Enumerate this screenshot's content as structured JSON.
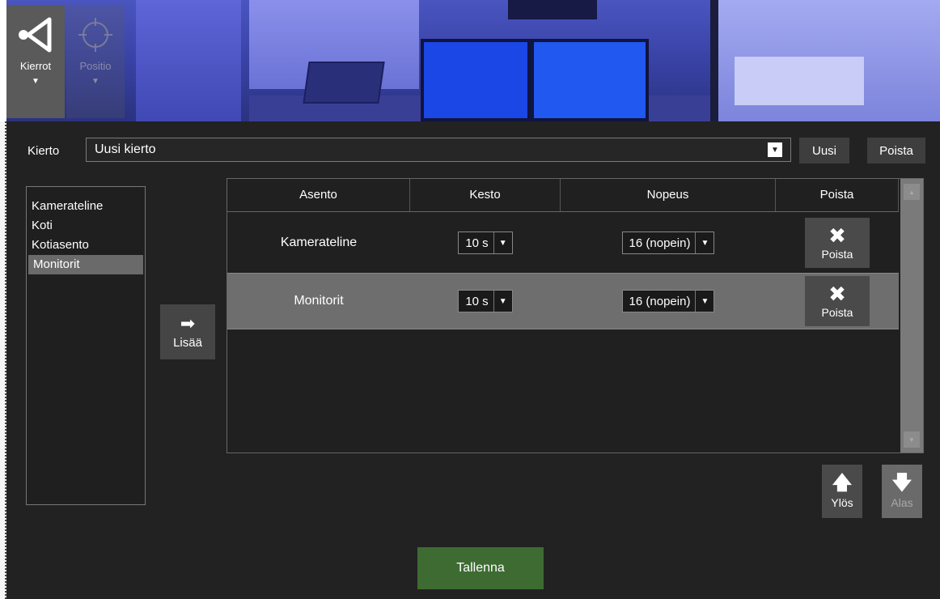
{
  "mode_buttons": {
    "tours_label": "Kierrot",
    "position_label": "Positio"
  },
  "tour": {
    "label": "Kierto",
    "selected": "Uusi kierto",
    "new_label": "Uusi",
    "delete_label": "Poista"
  },
  "positions": [
    "Kamerateline",
    "Koti",
    "Kotiasento",
    "Monitorit"
  ],
  "selected_position": "Monitorit",
  "add_label": "Lisää",
  "table": {
    "headers": [
      "Asento",
      "Kesto",
      "Nopeus",
      "Poista"
    ],
    "rows": [
      {
        "position": "Kamerateline",
        "duration": "10 s",
        "speed": "16 (nopein)",
        "delete_label": "Poista"
      },
      {
        "position": "Monitorit",
        "duration": "10 s",
        "speed": "16 (nopein)",
        "delete_label": "Poista"
      }
    ],
    "selected_row": 1
  },
  "move": {
    "up_label": "Ylös",
    "down_label": "Alas"
  },
  "save_label": "Tallenna",
  "colors": {
    "panel": "#222222",
    "save": "#3d6b32",
    "selected_row": "#6e6e6e"
  }
}
